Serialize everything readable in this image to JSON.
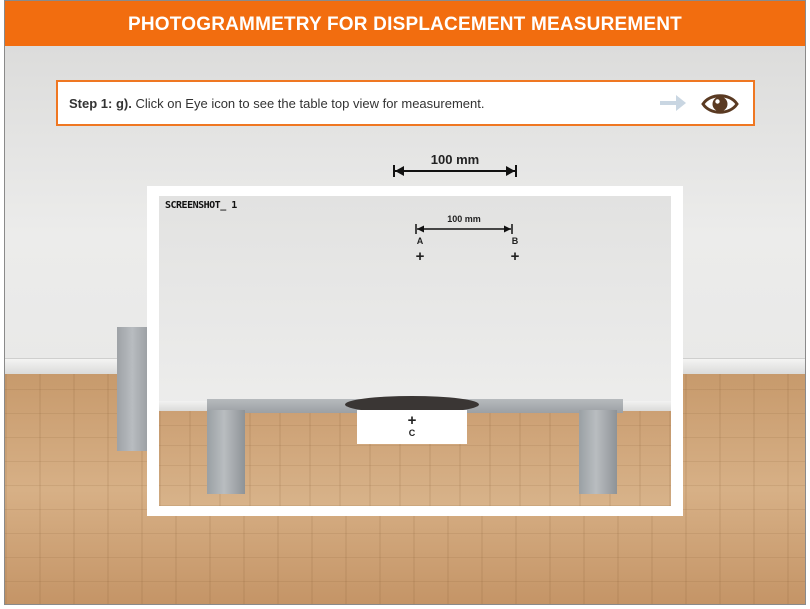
{
  "header": {
    "title": "PHOTOGRAMMETRY FOR DISPLACEMENT MEASUREMENT"
  },
  "instruction": {
    "step": "Step 1: g).",
    "text": " Click on Eye icon to see the table top view for measurement."
  },
  "icons": {
    "arrow": "arrow-right-icon",
    "eye": "eye-icon"
  },
  "colors": {
    "accent": "#f26d0f",
    "eye": "#5a3a22",
    "arrow": "#c9d6e2"
  },
  "scene": {
    "dimension_label": "100 mm"
  },
  "screenshot": {
    "title": "SCREENSHOT_ 1",
    "dimension_label": "100 mm",
    "point_a": "A",
    "point_b": "B",
    "point_c": "C",
    "plus": "+"
  }
}
